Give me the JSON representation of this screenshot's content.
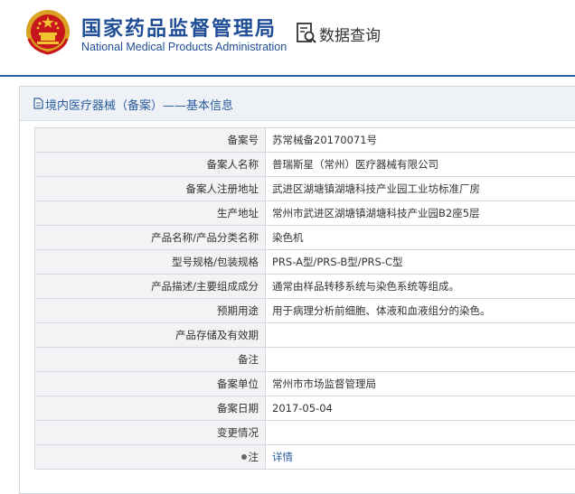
{
  "header": {
    "site_title": "国家药品监督管理局",
    "site_subtitle": "National Medical Products Administration",
    "query_label": "数据查询",
    "brand_color": "#1f4e96"
  },
  "panel": {
    "title": "境内医疗器械（备案）——基本信息"
  },
  "rows": [
    {
      "label": "备案号",
      "value": "苏常械备20170071号"
    },
    {
      "label": "备案人名称",
      "value": "普瑞斯星（常州）医疗器械有限公司"
    },
    {
      "label": "备案人注册地址",
      "value": "武进区湖塘镇湖塘科技产业园工业坊标准厂房"
    },
    {
      "label": "生产地址",
      "value": "常州市武进区湖塘镇湖塘科技产业园B2座5层"
    },
    {
      "label": "产品名称/产品分类名称",
      "value": "染色机"
    },
    {
      "label": "型号规格/包装规格",
      "value": "PRS-A型/PRS-B型/PRS-C型"
    },
    {
      "label": "产品描述/主要组成成分",
      "value": "通常由样品转移系统与染色系统等组成。"
    },
    {
      "label": "预期用途",
      "value": "用于病理分析前细胞、体液和血液组分的染色。"
    },
    {
      "label": "产品存储及有效期",
      "value": ""
    },
    {
      "label": "备注",
      "value": ""
    },
    {
      "label": "备案单位",
      "value": "常州市市场监督管理局"
    },
    {
      "label": "备案日期",
      "value": "2017-05-04"
    },
    {
      "label": "变更情况",
      "value": ""
    },
    {
      "label": "注",
      "value": "详情"
    }
  ]
}
